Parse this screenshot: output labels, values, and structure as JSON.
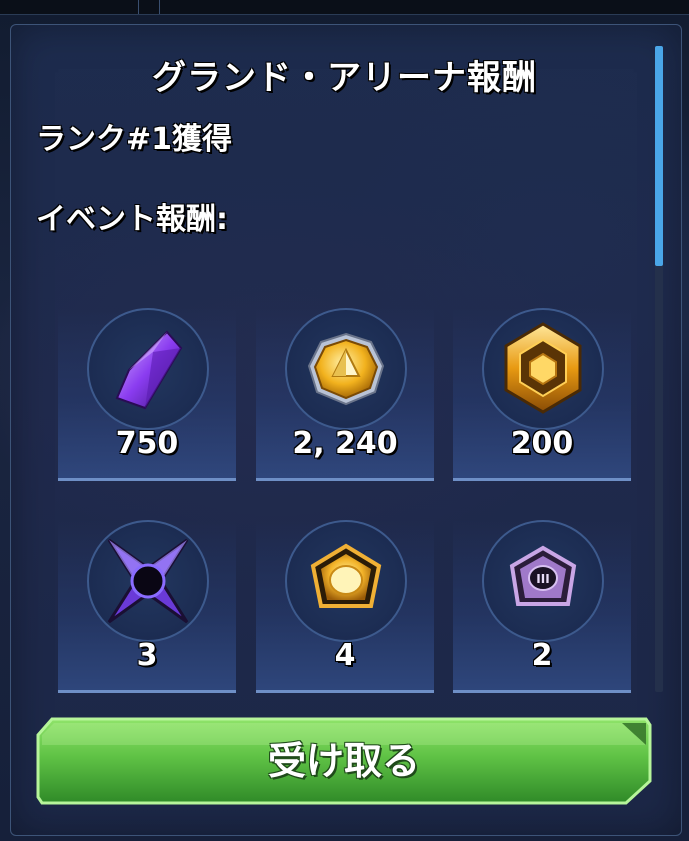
{
  "dialog": {
    "title": "グランド・アリーナ報酬",
    "rank_text": "ランク#1獲得",
    "event_rewards_label": "イベント報酬:"
  },
  "rewards": [
    {
      "icon": "purple-crystal-icon",
      "amount": "750"
    },
    {
      "icon": "gold-coin-icon",
      "amount": "2, 240"
    },
    {
      "icon": "gold-hex-token-icon",
      "amount": "200"
    },
    {
      "icon": "purple-star-material-icon",
      "amount": "3"
    },
    {
      "icon": "gold-gear-material-icon",
      "amount": "4"
    },
    {
      "icon": "purple-gear-material-icon",
      "amount": "2"
    }
  ],
  "purple_gear_numeral": "III",
  "claim_button": {
    "label": "受け取る"
  },
  "colors": {
    "accent_green": "#5fc245",
    "scroll_blue": "#4aa6e8",
    "panel": "#1e2d50"
  }
}
